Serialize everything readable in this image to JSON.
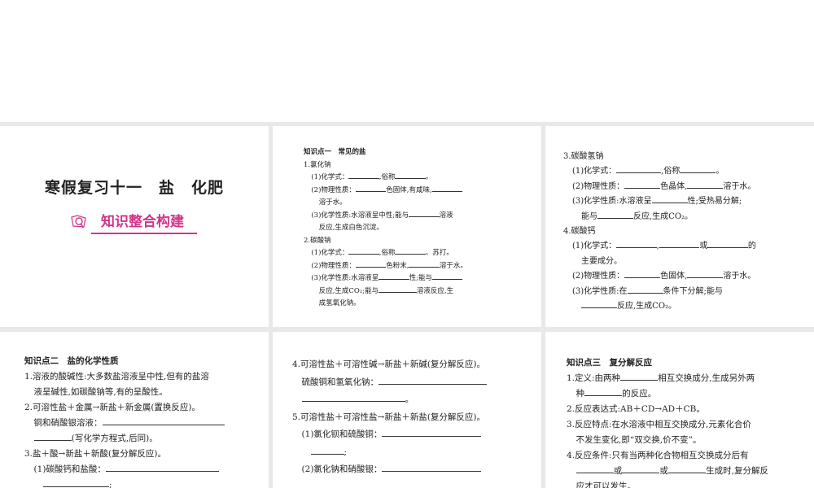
{
  "slide1": {
    "title": "寒假复习十一　盐　化肥",
    "badge": "知识整合构建",
    "badge_icon": "magnifier-folder-icon",
    "accent": "#d4338a"
  },
  "slide2": {
    "lines": [
      {
        "t": "知识点一　常见的盐",
        "i": 0,
        "h": true
      },
      {
        "t": "1.氯化钠",
        "i": 0
      },
      {
        "t": "(1)化学式：________,俗称________。",
        "i": 1
      },
      {
        "t": "(2)物理性质：________色固体,有咸味,________",
        "i": 1
      },
      {
        "t": "溶于水。",
        "i": 2
      },
      {
        "t": "(3)化学性质:水溶液呈中性;能与________溶液",
        "i": 1
      },
      {
        "t": "反应,生成白色沉淀。",
        "i": 2
      },
      {
        "t": "2.碳酸钠",
        "i": 0
      },
      {
        "t": "(1)化学式：________,俗称________、苏打。",
        "i": 1
      },
      {
        "t": "(2)物理性质：________色粉末,________溶于水。",
        "i": 1
      },
      {
        "t": "(3)化学性质:水溶液呈________性;能与________",
        "i": 1
      },
      {
        "t": "反应,生成CO₂;能与__________溶液反应,生",
        "i": 2
      },
      {
        "t": "成氢氧化钠。",
        "i": 2
      }
    ]
  },
  "slide3": {
    "lines": [
      {
        "t": "3.碳酸氢钠",
        "i": 0
      },
      {
        "t": "(1)化学式：__________,俗称________。",
        "i": 1
      },
      {
        "t": "(2)物理性质：________色晶体,________溶于水。",
        "i": 1
      },
      {
        "t": "(3)化学性质:水溶液呈________性;受热易分解;",
        "i": 1
      },
      {
        "t": "能与________反应,生成CO₂。",
        "i": 2
      },
      {
        "t": "4.碳酸钙",
        "i": 0
      },
      {
        "t": "(1)化学式：_________,_________或_________的",
        "i": 1
      },
      {
        "t": "主要成分。",
        "i": 2
      },
      {
        "t": "(2)物理性质：________色固体,________溶于水。",
        "i": 1
      },
      {
        "t": "(3)化学性质:在________条件下分解;能与",
        "i": 1
      },
      {
        "t": "________反应,生成CO₂。",
        "i": 2
      }
    ]
  },
  "slide4": {
    "lines": [
      {
        "t": "知识点二　盐的化学性质",
        "i": 0,
        "h": true
      },
      {
        "t": "1.溶液的酸碱性:大多数盐溶液呈中性,但有的盐溶",
        "i": 0
      },
      {
        "t": "液呈碱性,如碳酸钠等,有的呈酸性。",
        "i": 1
      },
      {
        "t": "2.可溶性盐＋金属→新盐＋新金属(置换反应)。",
        "i": 0
      },
      {
        "t": "铜和硝酸银溶液：__________________________",
        "i": 1
      },
      {
        "t": "________(写化学方程式,后同)。",
        "i": 1
      },
      {
        "t": "3.盐＋酸→新盐＋新酸(复分解反应)。",
        "i": 0
      },
      {
        "t": "(1)碳酸钙和盐酸：________________________",
        "i": 1
      },
      {
        "t": "______________;",
        "i": 2
      }
    ]
  },
  "slide5": {
    "lines": [
      {
        "t": "4.可溶性盐＋可溶性碱→新盐＋新碱(复分解反应)。",
        "i": 0
      },
      {
        "t": "硫酸铜和氢氧化钠：_______________________",
        "i": 1
      },
      {
        "t": "______________________。",
        "i": 1
      },
      {
        "t": "5.可溶性盐＋可溶性盐→新盐＋新盐(复分解反应)。",
        "i": 0
      },
      {
        "t": "(1)氯化钡和硫酸铜：_____________________",
        "i": 1
      },
      {
        "t": "_______;",
        "i": 2
      },
      {
        "t": "(2)氯化钠和硝酸银：_____________________",
        "i": 1
      },
      {
        "t": "________。",
        "i": 2
      }
    ]
  },
  "slide6": {
    "lines": [
      {
        "t": "知识点三　复分解反应",
        "i": 0,
        "h": true
      },
      {
        "t": "1.定义:由两种________相互交换成分,生成另外两",
        "i": 0
      },
      {
        "t": "种________的反应。",
        "i": 1
      },
      {
        "t": "2.反应表达式:AB＋CD→AD＋CB。",
        "i": 0
      },
      {
        "t": "3.反应特点:在水溶液中相互交换成分,元素化合价",
        "i": 0
      },
      {
        "t": "不发生变化,即“双交换,价不变”。",
        "i": 1
      },
      {
        "t": "4.反应条件:只有当两种化合物相互交换成分后有",
        "i": 0
      },
      {
        "t": "________或________或________生成时,复分解反",
        "i": 1
      },
      {
        "t": "应才可以发生。",
        "i": 1
      }
    ]
  }
}
